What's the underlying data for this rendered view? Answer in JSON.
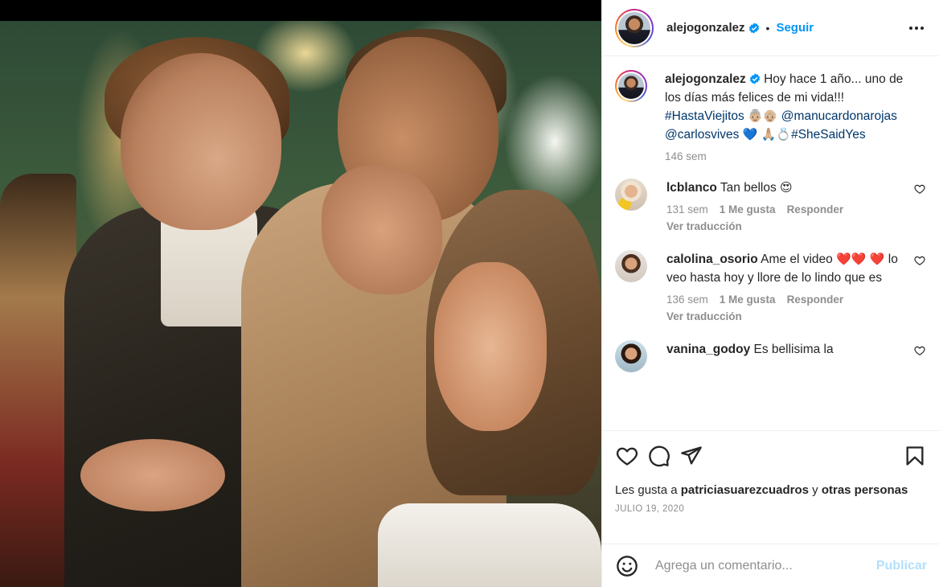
{
  "post": {
    "username": "alejogonzalez",
    "follow_label": "Seguir",
    "separator": "•",
    "caption": {
      "text_1": "Hoy hace 1 año... uno de los días más felices de mi vida!!! ",
      "hashtag_1": "#HastaViejitos",
      "emoji_1": "👵🏼👴🏼",
      "mention_1": "@manucardonarojas",
      "mention_2": "@carlosvives",
      "emoji_2": "💙",
      "emoji_3": "🙏🏼💍",
      "hashtag_2": "#SheSaidYes",
      "time": "146 sem"
    }
  },
  "comments": [
    {
      "username": "lcblanco",
      "text": "Tan bellos ",
      "emoji": "😍",
      "time": "131 sem",
      "likes": "1 Me gusta",
      "reply": "Responder",
      "translate": "Ver traducción"
    },
    {
      "username": "calolina_osorio",
      "text": "Ame el video ",
      "emoji_a": "❤️❤️",
      "emoji_b": "❤️",
      "text_b": " lo veo hasta hoy y llore de lo lindo que es",
      "time": "136 sem",
      "likes": "1 Me gusta",
      "reply": "Responder",
      "translate": "Ver traducción"
    },
    {
      "username": "vanina_godoy",
      "text": "Es bellisima la"
    }
  ],
  "likes_line": {
    "prefix": "Les gusta a ",
    "user": "patriciasuarezcuadros",
    "middle": " y ",
    "others": "otras personas"
  },
  "date": "JULIO 19, 2020",
  "add_comment": {
    "placeholder": "Agrega un comentario...",
    "publish_label": "Publicar"
  },
  "colors": {
    "accent": "#0095f6",
    "publish_disabled": "#b2dffc",
    "muted": "#8e8e8e",
    "text": "#262626"
  },
  "icons": [
    "verified-icon",
    "more-icon",
    "heart-icon",
    "comment-icon",
    "share-icon",
    "save-icon",
    "emoji-icon",
    "small-heart-icon"
  ]
}
